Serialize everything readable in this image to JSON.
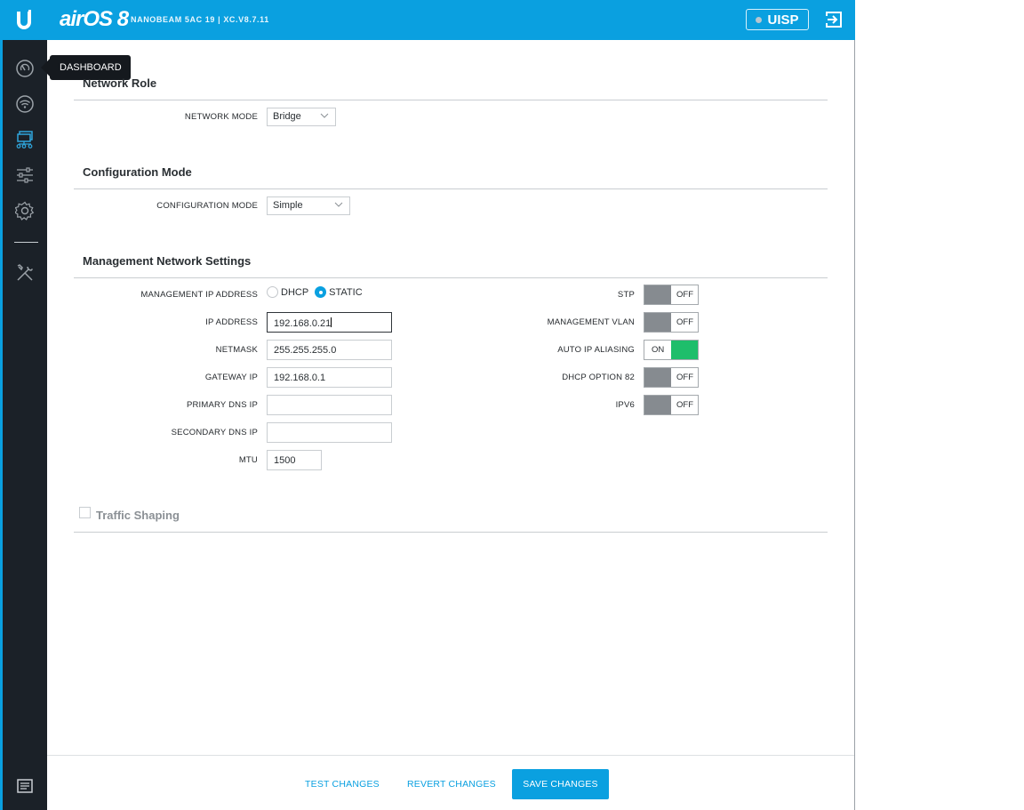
{
  "header": {
    "product": "airOS 8",
    "device": "NANOBEAM 5AC 19 | XC.V8.7.11",
    "uisp_label": "UISP"
  },
  "sidebar": {
    "tooltip": "DASHBOARD",
    "items": [
      {
        "icon": "dashboard-icon"
      },
      {
        "icon": "wireless-icon"
      },
      {
        "icon": "network-icon"
      },
      {
        "icon": "services-icon"
      },
      {
        "icon": "system-icon"
      },
      {
        "icon": "tools-icon"
      },
      {
        "icon": "log-icon"
      }
    ]
  },
  "network_role": {
    "title": "Network Role",
    "network_mode_label": "NETWORK MODE",
    "network_mode_value": "Bridge"
  },
  "configuration_mode": {
    "title": "Configuration Mode",
    "label": "CONFIGURATION MODE",
    "value": "Simple"
  },
  "management": {
    "title": "Management Network Settings",
    "mgmt_ip_label": "MANAGEMENT IP ADDRESS",
    "dhcp_label": "DHCP",
    "static_label": "STATIC",
    "selected": "STATIC",
    "fields": {
      "ip_address": {
        "label": "IP ADDRESS",
        "value": "192.168.0.21"
      },
      "netmask": {
        "label": "NETMASK",
        "value": "255.255.255.0"
      },
      "gateway": {
        "label": "GATEWAY IP",
        "value": "192.168.0.1"
      },
      "primary_dns": {
        "label": "PRIMARY DNS IP",
        "value": ""
      },
      "secondary_dns": {
        "label": "SECONDARY DNS IP",
        "value": ""
      },
      "mtu": {
        "label": "MTU",
        "value": "1500"
      }
    },
    "toggles": {
      "stp": {
        "label": "STP",
        "state": "OFF"
      },
      "mgmt_vlan": {
        "label": "MANAGEMENT VLAN",
        "state": "OFF"
      },
      "auto_ip_aliasing": {
        "label": "AUTO IP ALIASING",
        "state": "ON"
      },
      "dhcp_option_82": {
        "label": "DHCP OPTION 82",
        "state": "OFF"
      },
      "ipv6": {
        "label": "IPV6",
        "state": "OFF"
      }
    }
  },
  "traffic_shaping": {
    "label": "Traffic Shaping",
    "checked": false
  },
  "footer": {
    "test": "TEST CHANGES",
    "revert": "REVERT CHANGES",
    "save": "SAVE CHANGES"
  },
  "colors": {
    "accent": "#0aa0e0",
    "sidebar": "#1b2128",
    "toggle_on": "#1ebe6b",
    "toggle_off": "#868b90"
  }
}
